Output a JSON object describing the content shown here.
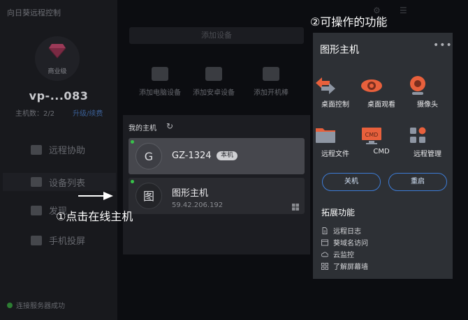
{
  "app": {
    "title": "向日葵远程控制"
  },
  "sidebar": {
    "tier": "商业级",
    "device_name": "vp-...083",
    "host_count": "主机数：2/2",
    "upgrade_link": "升级/续费",
    "nav": [
      {
        "label": "远程协助"
      },
      {
        "label": "设备列表"
      },
      {
        "label": "发现"
      },
      {
        "label": "手机投屏"
      }
    ],
    "status": "连接服务器成功"
  },
  "middle": {
    "add_device": "添加设备",
    "quick_actions": [
      {
        "label": "添加电脑设备"
      },
      {
        "label": "添加安卓设备"
      },
      {
        "label": "添加开机棒"
      }
    ]
  },
  "hosts": {
    "title": "我的主机",
    "items": [
      {
        "avatar": "G",
        "name": "GZ-1324",
        "badge": "本机",
        "online": true
      },
      {
        "avatar": "图",
        "name": "图形主机",
        "ip": "59.42.206.192",
        "online": true,
        "os_icon": "windows-icon"
      }
    ]
  },
  "annotations": {
    "step1": "①点击在线主机",
    "step2": "②可操作的功能"
  },
  "panel": {
    "title": "图形主机",
    "more": "•••",
    "functions": [
      {
        "label": "桌面控制",
        "icon": "desktop-control-icon"
      },
      {
        "label": "桌面观看",
        "icon": "eye-icon"
      },
      {
        "label": "摄像头",
        "icon": "camera-icon"
      },
      {
        "label": "远程文件",
        "icon": "folder-icon"
      },
      {
        "label": "CMD",
        "icon": "cmd-icon"
      },
      {
        "label": "远程管理",
        "icon": "manage-icon"
      }
    ],
    "buttons": {
      "shutdown": "关机",
      "restart": "重启"
    },
    "extensions_title": "拓展功能",
    "extensions": [
      {
        "label": "远程日志",
        "icon": "document-icon"
      },
      {
        "label": "葵域名访问",
        "icon": "browser-icon"
      },
      {
        "label": "云监控",
        "icon": "cloud-icon"
      },
      {
        "label": "了解屏幕墙",
        "icon": "grid-icon"
      }
    ],
    "colors": {
      "accent_orange": "#e8603c",
      "button_border": "#3d7cd6",
      "online": "#38c24a"
    }
  }
}
